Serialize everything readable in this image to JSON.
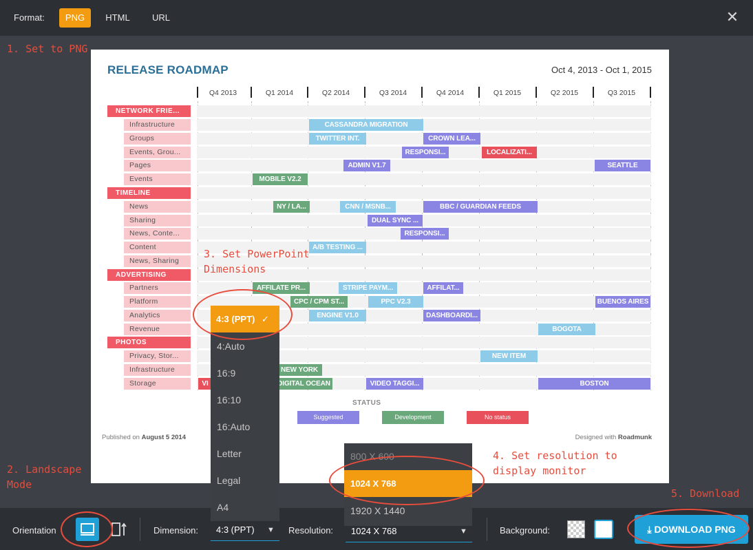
{
  "format": {
    "label": "Format:",
    "options": [
      "PNG",
      "HTML",
      "URL"
    ],
    "selected": "PNG"
  },
  "close_glyph": "✕",
  "annotations": {
    "step1": "1. Set to PNG",
    "step2": "2. Landscape\nMode",
    "step3": "3. Set PowerPoint\nDimensions",
    "step4": "4. Set resolution to\ndisplay monitor",
    "step5": "5. Download"
  },
  "roadmap": {
    "title": "RELEASE ROADMAP",
    "date_range": "Oct 4, 2013 - Oct 1, 2015",
    "quarters": [
      "Q4 2013",
      "Q1 2014",
      "Q2 2014",
      "Q3 2014",
      "Q4 2014",
      "Q1 2015",
      "Q2 2015",
      "Q3 2015"
    ],
    "categories": [
      {
        "name": "NETWORK FRIE...",
        "rows": [
          "Infrastructure",
          "Groups",
          "Events, Grou...",
          "Pages",
          "Events"
        ]
      },
      {
        "name": "TIMELINE",
        "rows": [
          "News",
          "Sharing",
          "News, Conte...",
          "Content",
          "News, Sharing"
        ]
      },
      {
        "name": "ADVERTISING",
        "rows": [
          "Partners",
          "Platform",
          "Analytics",
          "Revenue"
        ]
      },
      {
        "name": "PHOTOS",
        "rows": [
          "Privacy, Stor...",
          "Infrastructure",
          "Storage"
        ]
      }
    ],
    "bars": [
      {
        "label": "CASSANDRA MIGRATION",
        "status": "Suggested"
      },
      {
        "label": "TWITTER INT.",
        "status": "Suggested"
      },
      {
        "label": "CROWN LEA...",
        "status": "Development"
      },
      {
        "label": "RESPONSI...",
        "status": "Development"
      },
      {
        "label": "LOCALIZATI...",
        "status": "No status"
      },
      {
        "label": "ADMIN V1.7",
        "status": "Development"
      },
      {
        "label": "SEATTLE",
        "status": "Development"
      },
      {
        "label": "MOBILE V2.2",
        "status": "Development"
      },
      {
        "label": "NY / LA...",
        "status": "Development"
      },
      {
        "label": "CNN / MSNB...",
        "status": "Suggested"
      },
      {
        "label": "BBC / GUARDIAN FEEDS",
        "status": "Development"
      },
      {
        "label": "DUAL SYNC ...",
        "status": "Development"
      },
      {
        "label": "RESPONSI...",
        "status": "Development"
      },
      {
        "label": "A/B TESTING ...",
        "status": "Suggested"
      },
      {
        "label": "AFFILATE PR...",
        "status": "Development"
      },
      {
        "label": "STRIPE PAYM...",
        "status": "Suggested"
      },
      {
        "label": "AFFILAT...",
        "status": "Development"
      },
      {
        "label": "CPC / CPM ST...",
        "status": "Development"
      },
      {
        "label": "PPC V2.3",
        "status": "Suggested"
      },
      {
        "label": "BUENOS AIRES",
        "status": "Development"
      },
      {
        "label": "ENGINE V1.0",
        "status": "Suggested"
      },
      {
        "label": "DASHBOARDI...",
        "status": "Development"
      },
      {
        "label": "BOGOTA",
        "status": "Suggested"
      },
      {
        "label": "NEW ITEM",
        "status": "Suggested"
      },
      {
        "label": "NEW YORK",
        "status": "Development"
      },
      {
        "label": "DIGITAL OCEAN",
        "status": "Development"
      },
      {
        "label": "VIDEO TAGGI...",
        "status": "Development"
      },
      {
        "label": "BOSTON",
        "status": "Development"
      },
      {
        "label": "VI",
        "status": "No status"
      }
    ],
    "status_title": "STATUS",
    "legend": [
      "Suggested",
      "Development",
      "No status"
    ],
    "published_prefix": "Published on ",
    "published_date": "August 5 2014",
    "designed_prefix": "Designed with ",
    "designed_brand": "Roadmunk"
  },
  "dimension_dropdown": {
    "options": [
      "4:3 (PPT)",
      "4:Auto",
      "16:9",
      "16:10",
      "16:Auto",
      "Letter",
      "Legal",
      "A4"
    ],
    "selected": "4:3 (PPT)",
    "check_glyph": "✓"
  },
  "resolution_dropdown": {
    "options": [
      "800 X 600",
      "1024 X 768",
      "1920 X 1440"
    ],
    "selected": "1024 X 768"
  },
  "bottom": {
    "orientation_label": "Orientation",
    "dimension_label": "Dimension:",
    "dimension_value": "4:3 (PPT)",
    "resolution_label": "Resolution:",
    "resolution_value": "1024 X 768",
    "background_label": "Background:",
    "download_label": "DOWNLOAD PNG",
    "download_glyph": "⤓",
    "caret_glyph": "▼"
  },
  "colors": {
    "accent_orange": "#f39c12",
    "accent_blue": "#1fa1d8",
    "annotation_red": "#e74c3c",
    "suggested": "#8a84e2",
    "development": "#6aa87c",
    "no_status": "#e8505c",
    "category": "#f05a67",
    "subrow": "#f8c8cc"
  },
  "icons": [
    "close-icon",
    "landscape-icon",
    "portrait-icon",
    "check-icon",
    "caret-down-icon",
    "download-icon",
    "transparent-bg-icon",
    "white-bg-icon"
  ]
}
